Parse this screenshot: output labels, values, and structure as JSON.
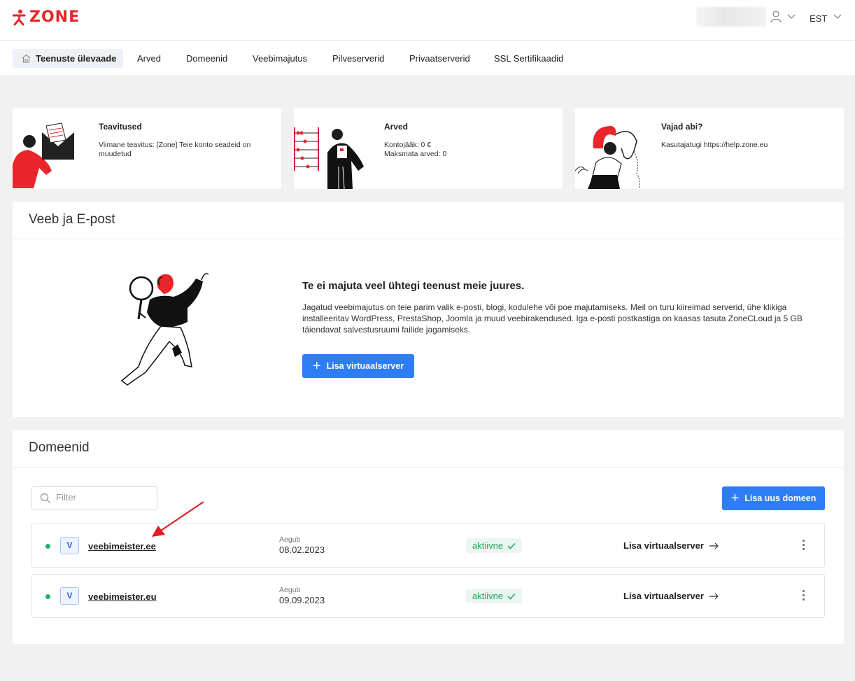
{
  "header": {
    "logo_text": "zone",
    "language": "EST"
  },
  "nav": {
    "items": [
      {
        "label": "Teenuste ülevaade"
      },
      {
        "label": "Arved"
      },
      {
        "label": "Domeenid"
      },
      {
        "label": "Veebimajutus"
      },
      {
        "label": "Pilveserverid"
      },
      {
        "label": "Privaatserverid"
      },
      {
        "label": "SSL Sertifikaadid"
      }
    ]
  },
  "info_cards": [
    {
      "title": "Teavitused",
      "text": "Viimane teavitus: [Zone] Teie konto seadeid on muudetud"
    },
    {
      "title": "Arved",
      "line1": "Kontojääk: 0 €",
      "line2": "Maksmata arved: 0"
    },
    {
      "title": "Vajad abi?",
      "text": "Kasutajatugi https://help.zone.eu"
    }
  ],
  "web_panel": {
    "title": "Veeb ja E-post",
    "empty_title": "Te ei majuta veel ühtegi teenust meie juures.",
    "empty_desc": "Jagatud veebimajutus on teie parim valik e-posti, blogi, kodulehe või poe majutamiseks. Meil on turu kiireimad serverid, ühe klikiga installeeritav WordPress, PrestaShop, Joomla ja muud veebirakendused. Iga e-posti postkastiga on kaasas tasuta ZoneCLoud ja 5 GB täiendavat salvestusruumi failide jagamiseks.",
    "add_button": "Lisa virtuaalserver"
  },
  "domains_panel": {
    "title": "Domeenid",
    "filter_placeholder": "Filter",
    "add_button": "Lisa uus domeen",
    "rows": [
      {
        "badge": "V",
        "name": "veebimeister.ee",
        "expires_label": "Aegub",
        "expires": "08.02.2023",
        "status": "aktiivne",
        "action": "Lisa virtuaalserver"
      },
      {
        "badge": "V",
        "name": "veebimeister.eu",
        "expires_label": "Aegub",
        "expires": "09.09.2023",
        "status": "aktiivne",
        "action": "Lisa virtuaalserver"
      }
    ]
  },
  "colors": {
    "brand_red": "#e8262b",
    "primary_blue": "#2f7df6",
    "active_green": "#19a763",
    "annotation_red": "#e31e24"
  }
}
